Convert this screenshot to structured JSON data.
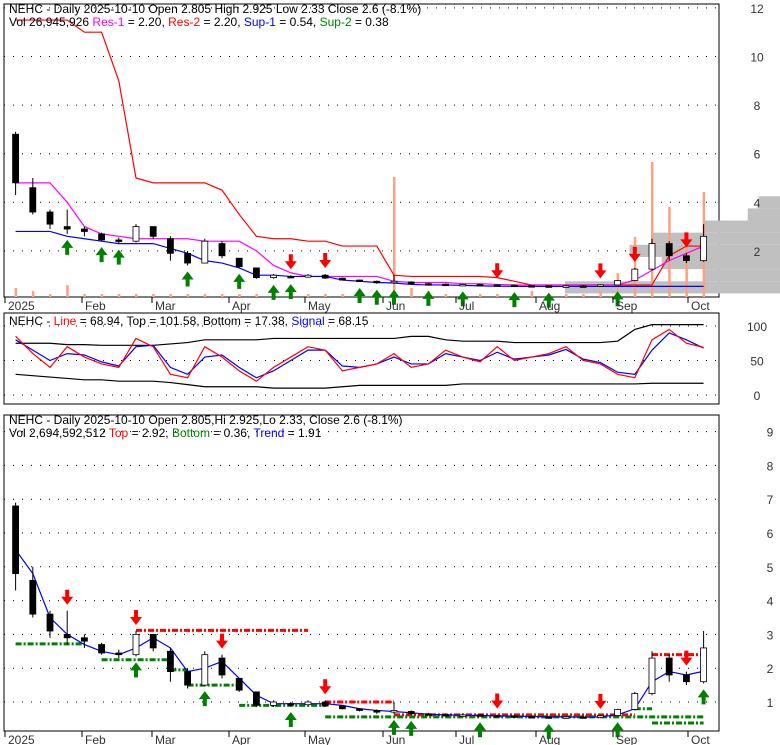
{
  "colors": {
    "up": "#ffffff",
    "down": "#000000",
    "res1": "#ff00ff",
    "res2": "#ff0000",
    "sup1": "#0000ff",
    "sup2": "#008000",
    "volume": "#ffa080",
    "profile": "#c0c0c0",
    "arrowUp": "#008000",
    "arrowDown": "#ff0000"
  },
  "panel1": {
    "title": "NEHC - Daily 2025-10-10 Open 2.805  High 2.925  Low 2.33  Close 2.6 (-8.1%)",
    "vol_label": "Vol 26,945,926",
    "res1_label": "Res-1",
    "res1_value": " = 2.20, ",
    "res2_label": "Res-2",
    "res2_value": " = 2.20, ",
    "sup1_label": "Sup-1",
    "sup1_value": " = 0.54, ",
    "sup2_label": "Sup-2",
    "sup2_value": " = 0.38",
    "yticks": [
      "12",
      "10",
      "8",
      "6",
      "4",
      "2"
    ]
  },
  "panel2": {
    "prefix": "NEHC - ",
    "line_label": "Line",
    "line_value": " = 68.94, Top = 101.58, Bottom = 17.38, ",
    "signal_label": "Signal",
    "signal_value": " = 68.15",
    "yticks": [
      "100",
      "50",
      "0"
    ]
  },
  "panel3": {
    "title": "NEHC - Daily 2025-10-10 Open 2.805,Hi 2.925,Lo 2.33, Close 2.6 (-8.1%)",
    "vol_label": "Vol 2,694,592,512 ",
    "top_label": "Top",
    "top_value": " = 2.92, ",
    "bottom_label": "Bottom",
    "bottom_value": " = 0.36, ",
    "trend_label": "Trend",
    "trend_value": " = 1.91",
    "yticks": [
      "9",
      "8",
      "7",
      "6",
      "5",
      "4",
      "3",
      "2",
      "1"
    ]
  },
  "xticks": [
    "2025",
    "Feb",
    "Mar",
    "Apr",
    "May",
    "Jun",
    "Jul",
    "Aug",
    "Sep",
    "Oct"
  ],
  "chart_data": {
    "type": "candlestick",
    "ticker": "NEHC",
    "period": "weekly approximation of daily 2025-01-02 to 2025-10-10",
    "ohlc": [
      [
        6.8,
        6.9,
        4.3,
        4.8
      ],
      [
        4.6,
        5.0,
        3.5,
        3.6
      ],
      [
        3.6,
        3.7,
        2.9,
        3.1
      ],
      [
        3.0,
        3.7,
        2.7,
        2.9
      ],
      [
        2.9,
        3.0,
        2.6,
        2.8
      ],
      [
        2.7,
        2.75,
        2.4,
        2.45
      ],
      [
        2.45,
        2.55,
        2.3,
        2.4
      ],
      [
        2.4,
        3.1,
        2.35,
        3.0
      ],
      [
        3.0,
        3.0,
        2.5,
        2.6
      ],
      [
        2.5,
        2.6,
        1.6,
        1.9
      ],
      [
        1.9,
        2.0,
        1.4,
        1.5
      ],
      [
        1.5,
        2.5,
        1.5,
        2.4
      ],
      [
        2.3,
        2.4,
        1.7,
        1.8
      ],
      [
        1.7,
        1.7,
        1.3,
        1.35
      ],
      [
        1.3,
        1.3,
        0.85,
        0.9
      ],
      [
        0.9,
        1.05,
        0.85,
        1.0
      ],
      [
        0.95,
        1.0,
        0.88,
        0.92
      ],
      [
        0.92,
        1.05,
        0.9,
        1.0
      ],
      [
        1.0,
        1.05,
        0.85,
        0.88
      ],
      [
        0.88,
        0.9,
        0.78,
        0.8
      ],
      [
        0.8,
        0.82,
        0.72,
        0.75
      ],
      [
        0.75,
        0.78,
        0.65,
        0.7
      ],
      [
        0.7,
        1.0,
        0.65,
        0.75
      ],
      [
        0.72,
        0.75,
        0.62,
        0.65
      ],
      [
        0.65,
        0.68,
        0.6,
        0.63
      ],
      [
        0.63,
        0.66,
        0.58,
        0.6
      ],
      [
        0.6,
        0.65,
        0.58,
        0.62
      ],
      [
        0.62,
        0.64,
        0.58,
        0.6
      ],
      [
        0.6,
        0.63,
        0.57,
        0.59
      ],
      [
        0.59,
        0.62,
        0.55,
        0.57
      ],
      [
        0.57,
        0.6,
        0.54,
        0.56
      ],
      [
        0.56,
        0.58,
        0.53,
        0.55
      ],
      [
        0.55,
        0.58,
        0.53,
        0.56
      ],
      [
        0.56,
        0.6,
        0.53,
        0.55
      ],
      [
        0.55,
        0.62,
        0.52,
        0.6
      ],
      [
        0.6,
        0.8,
        0.58,
        0.78
      ],
      [
        0.78,
        1.3,
        0.75,
        1.25
      ],
      [
        1.25,
        2.5,
        1.2,
        2.3
      ],
      [
        2.3,
        2.4,
        1.6,
        1.8
      ],
      [
        1.8,
        1.9,
        1.5,
        1.6
      ],
      [
        1.6,
        3.1,
        1.55,
        2.6
      ]
    ],
    "volume_relative": [
      3,
      2,
      1,
      4,
      1,
      1,
      1,
      1,
      1,
      1,
      1,
      1,
      1,
      1,
      1,
      1,
      1,
      1,
      1,
      1,
      1,
      1,
      40,
      3,
      2,
      1,
      1,
      1,
      1,
      1,
      2,
      1,
      1,
      1,
      2,
      8,
      20,
      45,
      30,
      20,
      35
    ],
    "res1": [
      4.8,
      4.8,
      4.8,
      4.0,
      3.0,
      2.7,
      2.6,
      2.5,
      2.5,
      2.5,
      2.5,
      2.4,
      2.4,
      2.4,
      2.0,
      1.4,
      1.1,
      0.95,
      0.95,
      0.95,
      0.95,
      0.95,
      0.75,
      0.7,
      0.7,
      0.7,
      0.65,
      0.65,
      0.62,
      0.6,
      0.6,
      0.6,
      0.6,
      0.6,
      0.6,
      0.6,
      0.8,
      1.2,
      1.6,
      1.9,
      2.2
    ],
    "res2": [
      11.5,
      11.5,
      11.5,
      11.5,
      11.0,
      11.0,
      9.0,
      5.0,
      4.8,
      4.8,
      4.8,
      4.8,
      4.5,
      3.5,
      2.6,
      2.5,
      2.5,
      2.4,
      2.4,
      2.2,
      2.2,
      2.2,
      1.0,
      0.95,
      0.95,
      0.95,
      0.95,
      0.95,
      0.9,
      0.75,
      0.6,
      0.6,
      0.6,
      0.6,
      0.6,
      0.6,
      0.6,
      0.6,
      1.8,
      2.2,
      2.2
    ],
    "sup1": [
      2.8,
      2.8,
      2.8,
      2.6,
      2.5,
      2.4,
      2.3,
      2.3,
      2.3,
      2.1,
      1.9,
      1.6,
      1.5,
      1.3,
      1.0,
      1.0,
      0.95,
      0.95,
      0.95,
      0.8,
      0.75,
      0.7,
      0.68,
      0.62,
      0.6,
      0.6,
      0.58,
      0.56,
      0.55,
      0.54,
      0.54,
      0.54,
      0.54,
      0.54,
      0.54,
      0.54,
      0.54,
      0.54,
      0.54,
      0.54,
      0.54
    ],
    "stoch_line": [
      85,
      60,
      40,
      70,
      55,
      45,
      40,
      82,
      70,
      30,
      25,
      70,
      55,
      35,
      20,
      40,
      55,
      70,
      65,
      35,
      40,
      45,
      60,
      40,
      45,
      65,
      55,
      48,
      70,
      50,
      55,
      60,
      70,
      50,
      45,
      30,
      25,
      80,
      95,
      75,
      69
    ],
    "stoch_signal": [
      80,
      65,
      50,
      60,
      58,
      48,
      42,
      70,
      72,
      40,
      30,
      55,
      58,
      40,
      25,
      35,
      50,
      65,
      65,
      42,
      40,
      45,
      55,
      45,
      45,
      60,
      55,
      50,
      62,
      52,
      55,
      58,
      66,
      52,
      47,
      33,
      30,
      65,
      90,
      80,
      68
    ],
    "stoch_top": [
      75,
      75,
      75,
      73,
      73,
      72,
      72,
      72,
      72,
      74,
      76,
      80,
      80,
      80,
      80,
      82,
      82,
      82,
      82,
      82,
      82,
      82,
      82,
      85,
      85,
      80,
      78,
      78,
      78,
      76,
      76,
      76,
      76,
      76,
      76,
      78,
      95,
      102,
      102,
      102,
      102
    ],
    "stoch_bottom": [
      30,
      28,
      26,
      24,
      22,
      22,
      20,
      20,
      20,
      18,
      15,
      12,
      12,
      12,
      12,
      10,
      10,
      10,
      10,
      12,
      14,
      14,
      14,
      14,
      14,
      14,
      16,
      16,
      16,
      16,
      16,
      16,
      16,
      16,
      16,
      16,
      16,
      17,
      17,
      17,
      17
    ],
    "trend": [
      5.5,
      4.8,
      3.5,
      3.0,
      2.7,
      2.5,
      2.4,
      2.6,
      2.9,
      2.6,
      1.9,
      2.0,
      2.2,
      1.7,
      1.2,
      0.95,
      0.95,
      0.95,
      0.95,
      0.9,
      0.8,
      0.75,
      0.72,
      0.68,
      0.64,
      0.62,
      0.61,
      0.6,
      0.59,
      0.58,
      0.57,
      0.56,
      0.56,
      0.55,
      0.56,
      0.62,
      0.8,
      1.6,
      1.9,
      1.8,
      1.91
    ],
    "resistance_segments": [
      {
        "from": 8,
        "to": 18,
        "price": 3.12
      },
      {
        "from": 19,
        "to": 23,
        "price": 1.0
      },
      {
        "from": 23,
        "to": 37,
        "price": 0.62
      },
      {
        "from": 38,
        "to": 41,
        "price": 2.4
      }
    ],
    "support_segments": [
      {
        "from": 1,
        "to": 5,
        "price": 2.72
      },
      {
        "from": 6,
        "to": 10,
        "price": 2.25
      },
      {
        "from": 10,
        "to": 11,
        "price": 1.95
      },
      {
        "from": 11,
        "to": 14,
        "price": 1.5
      },
      {
        "from": 14,
        "to": 19,
        "price": 0.9
      },
      {
        "from": 19,
        "to": 41,
        "price": 0.56
      },
      {
        "from": 37,
        "to": 38,
        "price": 0.8
      },
      {
        "from": 38,
        "to": 41,
        "price": 0.38
      }
    ],
    "arrows_panel3": [
      {
        "week": 4,
        "dir": "down"
      },
      {
        "week": 8,
        "dir": "down"
      },
      {
        "week": 8,
        "dir": "up"
      },
      {
        "week": 12,
        "dir": "up"
      },
      {
        "week": 13,
        "dir": "down"
      },
      {
        "week": 17,
        "dir": "up"
      },
      {
        "week": 19,
        "dir": "down"
      },
      {
        "week": 23,
        "dir": "up"
      },
      {
        "week": 24,
        "dir": "up"
      },
      {
        "week": 28,
        "dir": "up"
      },
      {
        "week": 29,
        "dir": "down"
      },
      {
        "week": 32,
        "dir": "up"
      },
      {
        "week": 35,
        "dir": "down"
      },
      {
        "week": 36,
        "dir": "up"
      },
      {
        "week": 40,
        "dir": "down"
      },
      {
        "week": 41,
        "dir": "up"
      }
    ],
    "arrows_panel1": [
      {
        "week": 4,
        "dir": "up"
      },
      {
        "week": 6,
        "dir": "up"
      },
      {
        "week": 7,
        "dir": "up"
      },
      {
        "week": 11,
        "dir": "up"
      },
      {
        "week": 14,
        "dir": "up"
      },
      {
        "week": 16,
        "dir": "up"
      },
      {
        "week": 17,
        "dir": "up"
      },
      {
        "week": 17,
        "dir": "down"
      },
      {
        "week": 19,
        "dir": "down"
      },
      {
        "week": 21,
        "dir": "up"
      },
      {
        "week": 22,
        "dir": "up"
      },
      {
        "week": 23,
        "dir": "up"
      },
      {
        "week": 25,
        "dir": "up"
      },
      {
        "week": 27,
        "dir": "up"
      },
      {
        "week": 29,
        "dir": "down"
      },
      {
        "week": 30,
        "dir": "up"
      },
      {
        "week": 32,
        "dir": "up"
      },
      {
        "week": 35,
        "dir": "down"
      },
      {
        "week": 36,
        "dir": "up"
      },
      {
        "week": 37,
        "dir": "down"
      },
      {
        "week": 40,
        "dir": "down"
      }
    ],
    "volume_by_price": [
      {
        "price": 0.5,
        "rel": 1.0
      },
      {
        "price": 1.0,
        "rel": 0.35
      },
      {
        "price": 1.5,
        "rel": 0.55
      },
      {
        "price": 2.0,
        "rel": 0.7
      },
      {
        "price": 2.5,
        "rel": 0.6
      },
      {
        "price": 3.0,
        "rel": 0.35
      },
      {
        "price": 3.5,
        "rel": 0.15
      },
      {
        "price": 4.0,
        "rel": 0.1
      }
    ],
    "ylim_panel1": [
      0,
      12.3
    ],
    "ylim_panel2": [
      -10,
      110
    ],
    "ylim_panel3": [
      0,
      9.5
    ]
  }
}
